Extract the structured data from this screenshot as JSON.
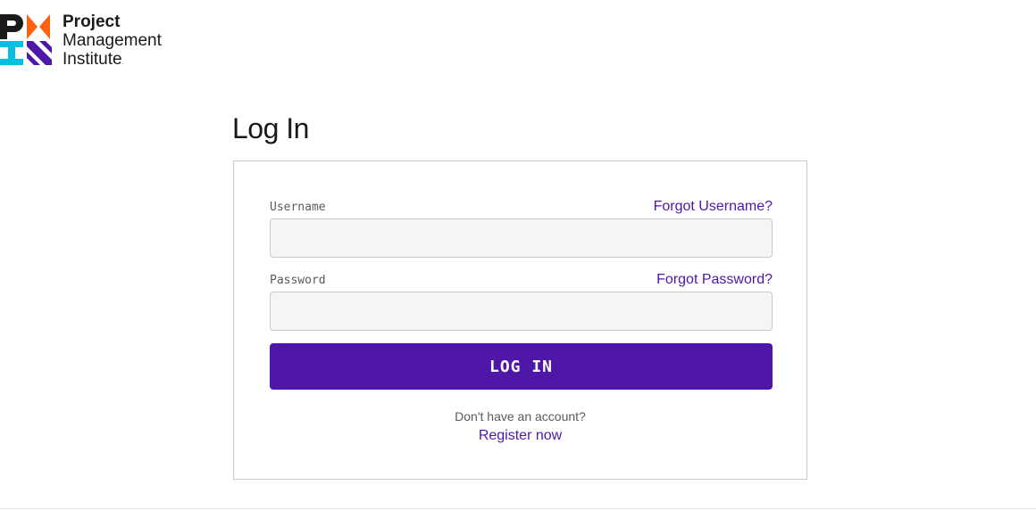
{
  "brand": {
    "logo_icon": "pmi-logo-icon",
    "name_line1": "Project",
    "name_line2": "Management",
    "name_line3": "Institute",
    "trademark": ".",
    "colors": {
      "black": "#1a1a1a",
      "orange": "#ff610f",
      "teal": "#05bfe0",
      "purple": "#4f17a8"
    }
  },
  "page": {
    "title": "Log In"
  },
  "form": {
    "username_label": "Username",
    "username_value": "",
    "forgot_username": "Forgot Username?",
    "password_label": "Password",
    "password_value": "",
    "forgot_password": "Forgot Password?",
    "login_button": "LOG IN",
    "no_account_text": "Don't have an account?",
    "register_link": "Register now"
  },
  "theme": {
    "accent": "#4f17a8",
    "input_bg": "#f4f5f7",
    "border": "#c9c9c9"
  }
}
